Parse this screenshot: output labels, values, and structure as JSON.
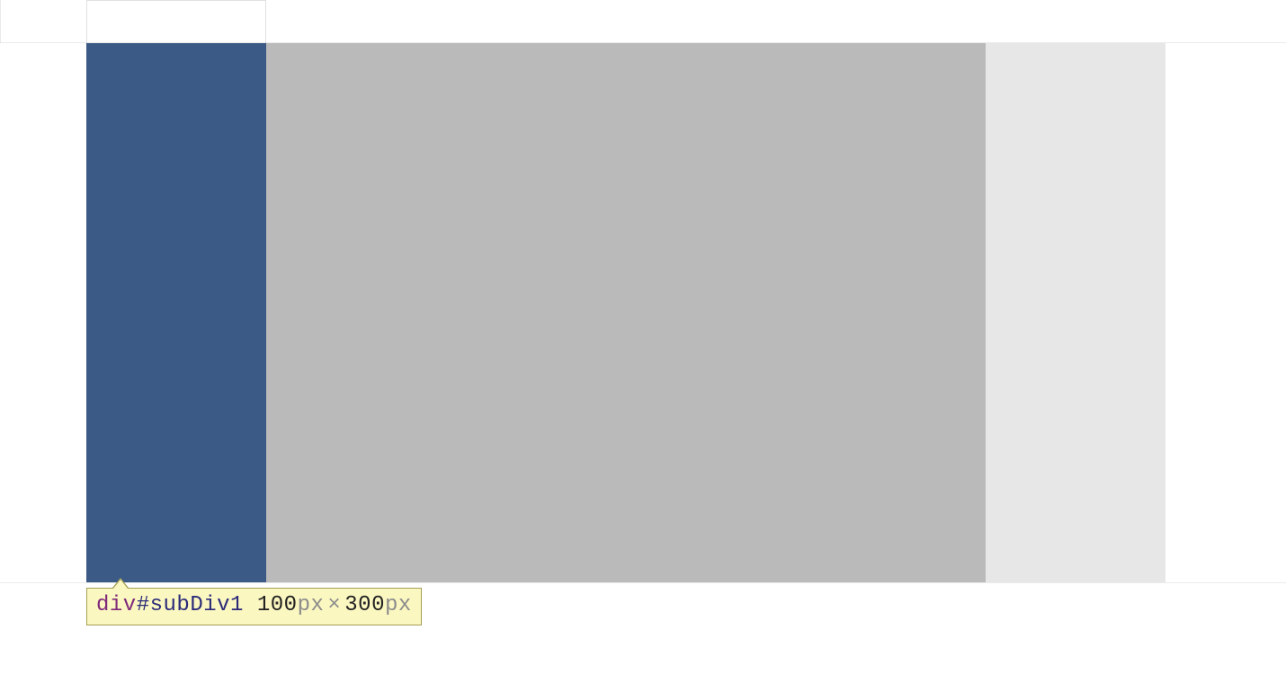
{
  "layout": {
    "columns": [
      {
        "id": "subDiv1",
        "color": "#3b5a85"
      },
      {
        "id": "subDiv2",
        "color": "#bababa"
      },
      {
        "id": "subDiv3",
        "color": "#e7e7e7"
      }
    ]
  },
  "tooltip": {
    "tag": "div",
    "selector": "#subDiv1",
    "width_value": "100",
    "width_unit": "px",
    "separator": "×",
    "height_value": "300",
    "height_unit": "px"
  }
}
